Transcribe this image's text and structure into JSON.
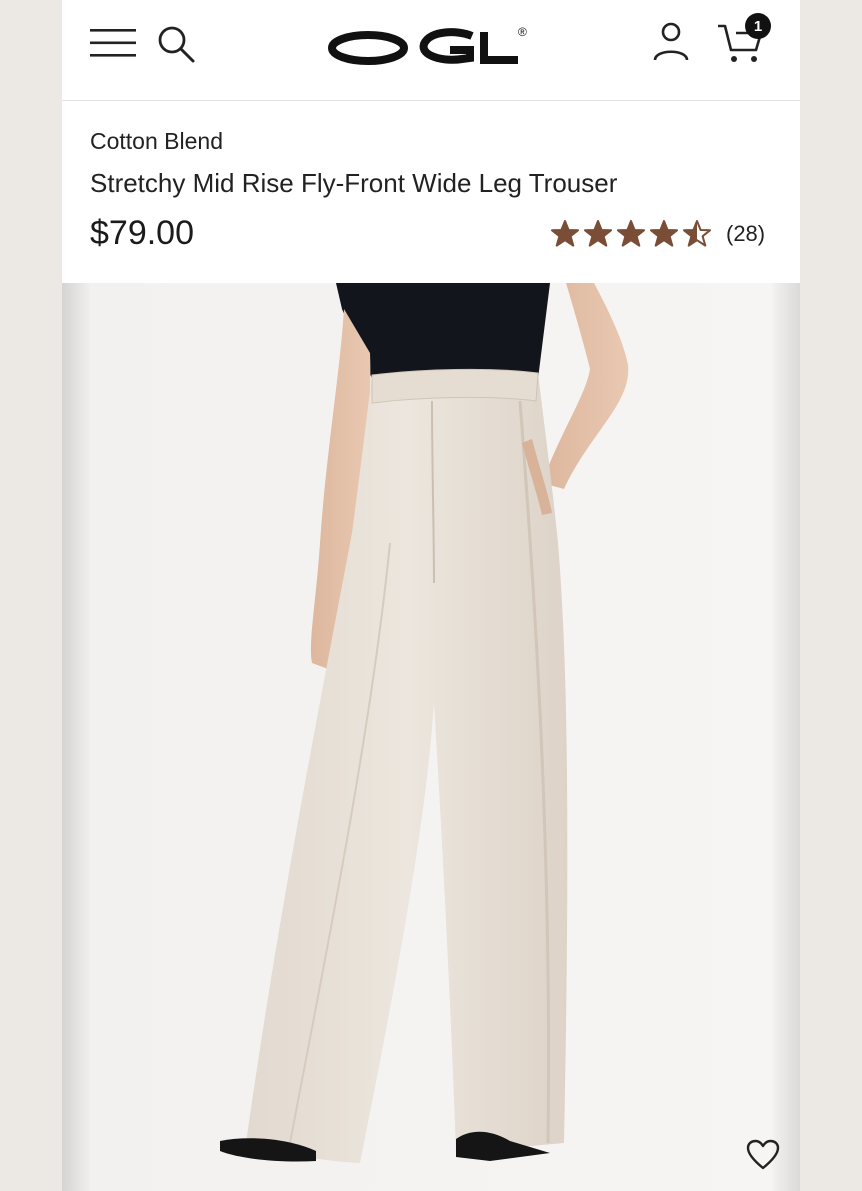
{
  "header": {
    "brand": "OGL",
    "brand_mark": "®",
    "cart_count": "1",
    "icons": [
      "menu-icon",
      "search-icon",
      "account-icon",
      "cart-icon"
    ]
  },
  "product": {
    "category": "Cotton Blend",
    "name": "Stretchy Mid Rise Fly-Front Wide Leg Trouser",
    "price": "$79.00",
    "rating": 4.5,
    "review_count": "(28)",
    "star_color": "#7a4e36"
  },
  "gallery": {
    "wishlist_icon": "heart-icon"
  }
}
